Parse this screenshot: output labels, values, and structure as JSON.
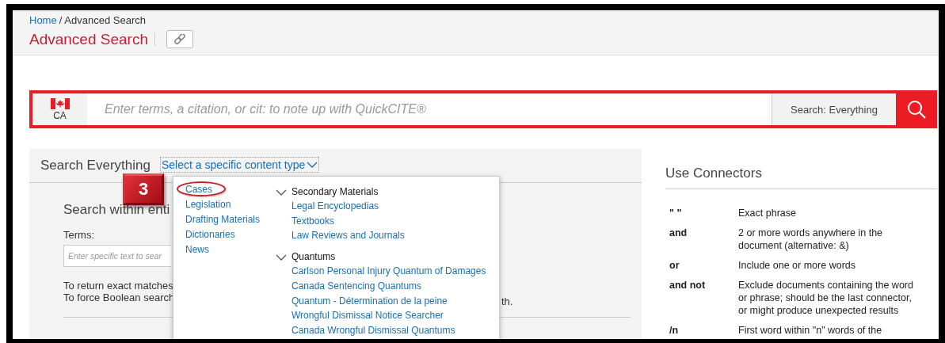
{
  "breadcrumb": {
    "home": "Home",
    "separator": "/",
    "current": "Advanced Search"
  },
  "page_title": "Advanced Search",
  "search_bar": {
    "jurisdiction": "CA",
    "placeholder": "Enter terms, a citation, or cit: to note up with QuickCITE®",
    "scope": "Search: Everything"
  },
  "search_panel": {
    "title": "Search Everything",
    "content_type_link": "Select a specific content type",
    "subtitle": "Search within enti",
    "terms_label": "Terms:",
    "terms_placeholder": "Enter specific text to sear",
    "help_lines": [
      "To return exact matches",
      "To force Boolean search"
    ],
    "help_tail": "th."
  },
  "content_type_menu": {
    "primary": [
      {
        "label": "Cases",
        "highlighted": true
      },
      {
        "label": "Legislation",
        "highlighted": false
      },
      {
        "label": "Drafting Materials",
        "highlighted": false
      },
      {
        "label": "Dictionaries",
        "highlighted": false
      },
      {
        "label": "News",
        "highlighted": false
      }
    ],
    "groups": [
      {
        "label": "Secondary Materials",
        "expanded": true,
        "children": [
          "Legal Encyclopedias",
          "Textbooks",
          "Law Reviews and Journals"
        ]
      },
      {
        "label": "Quantums",
        "expanded": true,
        "children": [
          "Carlson Personal Injury Quantum of Damages",
          "Canada Sentencing Quantums",
          "Quantum - Détermination de la peine",
          "Wrongful Dismissal Notice Searcher",
          "Canada Wrongful Dismissal Quantums"
        ]
      }
    ]
  },
  "callout": {
    "label": "3"
  },
  "connectors": {
    "title": "Use Connectors",
    "rows": [
      {
        "connector": "\" \"",
        "description": "Exact phrase"
      },
      {
        "connector": "and",
        "description": "2 or more words anywhere in the document (alternative: &)"
      },
      {
        "connector": "or",
        "description": "Include one or more words"
      },
      {
        "connector": "and not",
        "description": "Exclude documents containing the word or phrase; should be the last connector, or might produce unexpected results"
      },
      {
        "connector": "/n",
        "description": "First word within \"n\" words of the"
      }
    ]
  }
}
